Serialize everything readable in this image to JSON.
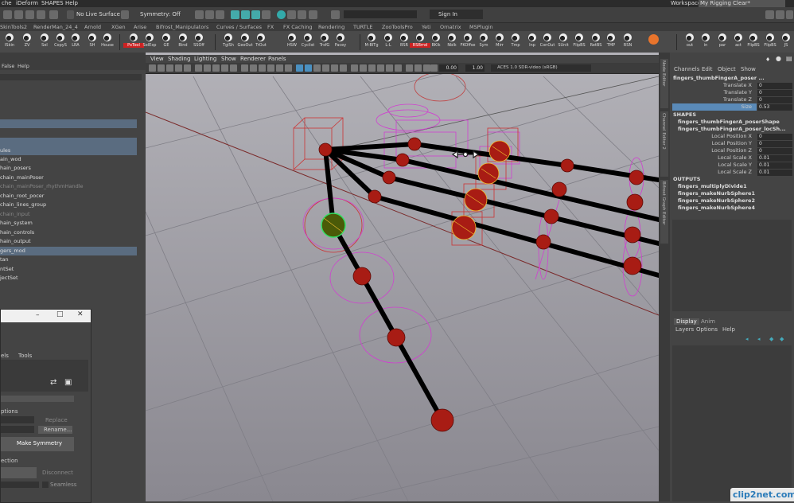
{
  "menubar": {
    "items": [
      "che",
      "iDeform",
      "SHAPES",
      "Help"
    ],
    "workspace_label": "Workspace :",
    "workspace_value": "My Rigging Clear*"
  },
  "status": {
    "live_surface": "No Live Surface",
    "symmetry": "Symmetry: Off",
    "sign_in": "Sign In"
  },
  "shelf_tabs": [
    "SkinTools2",
    "RenderMan_24_4",
    "Arnold",
    "XGen",
    "Arise",
    "Bifrost_Manipulators",
    "Curves / Surfaces",
    "FX",
    "FX Caching",
    "Rendering",
    "TURTLE",
    "ZooToolsPro",
    "Yeti",
    "Ornatrix",
    "MSPlugin"
  ],
  "shelf_buttons": [
    {
      "label": "ISkin",
      "color": "#eee"
    },
    {
      "label": "ZV",
      "color": "#eee"
    },
    {
      "label": "Sel",
      "color": "#eee"
    },
    {
      "label": "CopyS",
      "color": "#eee"
    },
    {
      "label": "LRA",
      "color": "#eee"
    },
    {
      "label": "SH",
      "color": "#eee"
    },
    {
      "label": "House",
      "color": "#eee"
    },
    {
      "label": "PxTool",
      "color": "#e33"
    },
    {
      "label": "SelExp",
      "color": "#eee"
    },
    {
      "label": "GE",
      "color": "#eee"
    },
    {
      "label": "Bind",
      "color": "#eee"
    },
    {
      "label": "SSOff",
      "color": "#eee"
    },
    {
      "label": "TglSh",
      "color": "#eee"
    },
    {
      "label": "GeoOut",
      "color": "#eee"
    },
    {
      "label": "TrOut",
      "color": "#eee"
    },
    {
      "label": "HSW",
      "color": "#eee"
    },
    {
      "label": "Cyclist",
      "color": "#eee"
    },
    {
      "label": "TrsfG",
      "color": "#eee"
    },
    {
      "label": "Facey",
      "color": "#eee"
    },
    {
      "label": "M-BlTg",
      "color": "#eee"
    },
    {
      "label": "L-L",
      "color": "#eee"
    },
    {
      "label": "BSR",
      "color": "#eee"
    },
    {
      "label": "RSBrnd",
      "color": "#e33"
    },
    {
      "label": "BKlk",
      "color": "#eee"
    },
    {
      "label": "Nblk",
      "color": "#eee"
    },
    {
      "label": "FKOffse",
      "color": "#eee"
    },
    {
      "label": "Sym",
      "color": "#eee"
    },
    {
      "label": "Mirr",
      "color": "#eee"
    },
    {
      "label": "Tmp",
      "color": "#eee"
    },
    {
      "label": "Inp",
      "color": "#eee"
    },
    {
      "label": "ConOut",
      "color": "#eee"
    },
    {
      "label": "SUnit",
      "color": "#eee"
    },
    {
      "label": "FlipBS",
      "color": "#eee"
    },
    {
      "label": "RetBS",
      "color": "#eee"
    },
    {
      "label": "TMP",
      "color": "#eee"
    },
    {
      "label": "RSN",
      "color": "#eee"
    },
    {
      "label": "out",
      "color": "#eee"
    },
    {
      "label": "in",
      "color": "#eee"
    },
    {
      "label": "par",
      "color": "#eee"
    },
    {
      "label": "act",
      "color": "#eee"
    },
    {
      "label": "FlipBS",
      "color": "#eee"
    },
    {
      "label": "FlipBS",
      "color": "#eee"
    },
    {
      "label": "JS",
      "color": "#eee"
    }
  ],
  "outliner": {
    "menu": [
      "False",
      "Help"
    ],
    "rows": [
      {
        "text": "ules",
        "sel": true
      },
      {
        "text": "ain_wod",
        "sel": false
      },
      {
        "text": "hain_posers",
        "sel": false
      },
      {
        "text": "chain_mainPoser",
        "sel": false
      },
      {
        "text": "chain_mainPoser_rhythmHandle",
        "sel": false,
        "dim": true
      },
      {
        "text": "chain_root_pocer",
        "sel": false
      },
      {
        "text": "chain_lines_group",
        "sel": false
      },
      {
        "text": "chain_input",
        "sel": false,
        "dim": true
      },
      {
        "text": "hain_system",
        "sel": false
      },
      {
        "text": "hain_controls",
        "sel": false
      },
      {
        "text": "hain_output",
        "sel": false
      },
      {
        "text": "gers_mod",
        "sel": true
      },
      {
        "text": "tan",
        "sel": false
      },
      {
        "text": "ntSet",
        "sel": false
      },
      {
        "text": "jectSet",
        "sel": false
      }
    ]
  },
  "dialog": {
    "tabs": [
      "els",
      "Tools"
    ],
    "section1": "ptions",
    "replace": "Replace",
    "rename": "Rename...",
    "make_symmetry": "Make Symmetry",
    "section2": "ection",
    "disconnect": "Disconnect",
    "seamless": "Seamless"
  },
  "viewport": {
    "menus": [
      "View",
      "Shading",
      "Lighting",
      "Show",
      "Renderer",
      "Panels"
    ],
    "field_a": "0.00",
    "field_b": "1.00",
    "colorspace": "ACES 1.0 SDR-video (sRGB)"
  },
  "side_tabs": [
    "Node Editor",
    "Channel Editor 2",
    "Bifrost Graph Editor"
  ],
  "channel": {
    "menus": [
      "Channels",
      "Edit",
      "Object",
      "Show"
    ],
    "object": "fingers_thumbFingerA_poser ...",
    "attrs": [
      {
        "name": "Translate X",
        "value": "0"
      },
      {
        "name": "Translate Y",
        "value": "0"
      },
      {
        "name": "Translate Z",
        "value": "0"
      },
      {
        "name": "Size",
        "value": "0.53",
        "sel": true
      }
    ],
    "shapes_title": "SHAPES",
    "shapes": [
      "fingers_thumbFingerA_poserShape",
      "fingers_thumbFingerA_poser_locSh..."
    ],
    "shape_attrs": [
      {
        "name": "Local Position X",
        "value": "0"
      },
      {
        "name": "Local Position Y",
        "value": "0"
      },
      {
        "name": "Local Position Z",
        "value": "0"
      },
      {
        "name": "Local Scale X",
        "value": "0.01"
      },
      {
        "name": "Local Scale Y",
        "value": "0.01"
      },
      {
        "name": "Local Scale Z",
        "value": "0.01"
      }
    ],
    "outputs_title": "OUTPUTS",
    "outputs": [
      "fingers_multiplyDivide1",
      "fingers_makeNurbSphere1",
      "fingers_makeNurbSphere2",
      "fingers_makeNurbSphere4"
    ],
    "display_tabs": [
      "Display",
      "Anim"
    ],
    "display_menus": [
      "Layers",
      "Options",
      "Help"
    ]
  },
  "watermark": "clip2net.com"
}
